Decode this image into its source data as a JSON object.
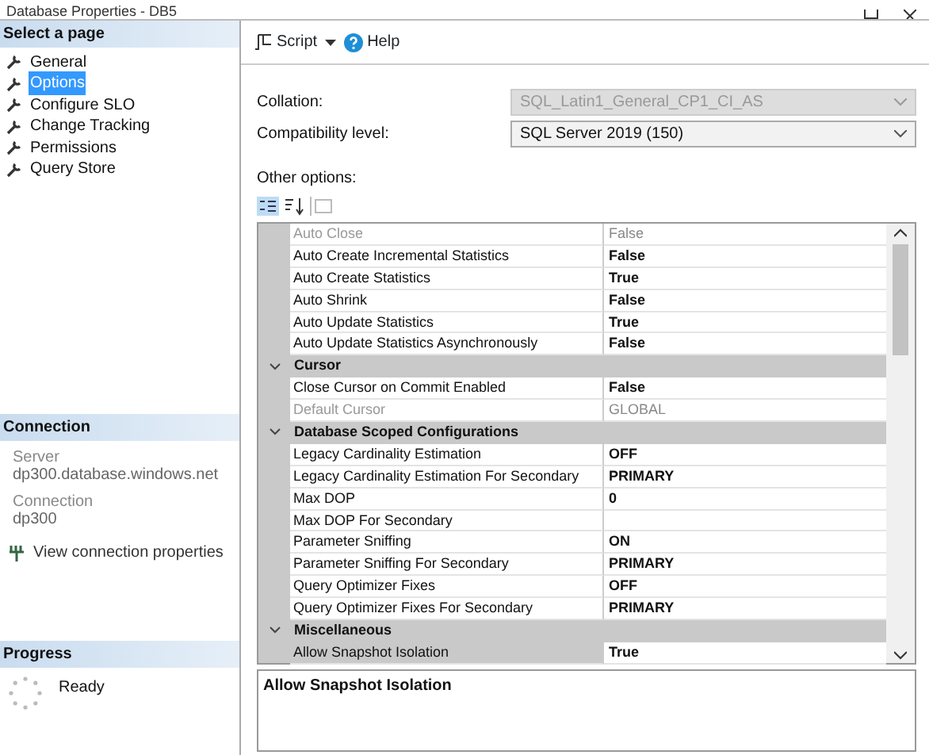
{
  "window": {
    "title": "Database Properties - DB5"
  },
  "sidebar": {
    "header": "Select a page",
    "items": [
      {
        "label": "General",
        "selected": false
      },
      {
        "label": "Options",
        "selected": true
      },
      {
        "label": "Configure SLO",
        "selected": false
      },
      {
        "label": "Change Tracking",
        "selected": false
      },
      {
        "label": "Permissions",
        "selected": false
      },
      {
        "label": "Query Store",
        "selected": false
      }
    ]
  },
  "connection": {
    "header": "Connection",
    "server_label": "Server",
    "server": "dp300.database.windows.net",
    "connection_label": "Connection",
    "connection": "dp300",
    "link": "View connection properties"
  },
  "progress": {
    "header": "Progress",
    "status": "Ready"
  },
  "toolbar": {
    "script": "Script",
    "help": "Help"
  },
  "collation": {
    "label": "Collation:",
    "value": "SQL_Latin1_General_CP1_CI_AS",
    "disabled": true
  },
  "compatibility": {
    "label": "Compatibility level:",
    "value": "SQL Server 2019 (150)",
    "disabled": false
  },
  "other_options": {
    "label": "Other options:"
  },
  "grid": [
    {
      "kind": "property",
      "name": "Auto Close",
      "value": "False",
      "bold": false,
      "disabled": true,
      "selected": false
    },
    {
      "kind": "property",
      "name": "Auto Create Incremental Statistics",
      "value": "False",
      "bold": true,
      "disabled": false,
      "selected": false
    },
    {
      "kind": "property",
      "name": "Auto Create Statistics",
      "value": "True",
      "bold": true,
      "disabled": false,
      "selected": false
    },
    {
      "kind": "property",
      "name": "Auto Shrink",
      "value": "False",
      "bold": true,
      "disabled": false,
      "selected": false
    },
    {
      "kind": "property",
      "name": "Auto Update Statistics",
      "value": "True",
      "bold": true,
      "disabled": false,
      "selected": false
    },
    {
      "kind": "property",
      "name": "Auto Update Statistics Asynchronously",
      "value": "False",
      "bold": true,
      "disabled": false,
      "selected": false
    },
    {
      "kind": "category",
      "name": "Cursor",
      "expanded": true
    },
    {
      "kind": "property",
      "name": "Close Cursor on Commit Enabled",
      "value": "False",
      "bold": true,
      "disabled": false,
      "selected": false
    },
    {
      "kind": "property",
      "name": "Default Cursor",
      "value": "GLOBAL",
      "bold": false,
      "disabled": true,
      "selected": false
    },
    {
      "kind": "category",
      "name": "Database Scoped Configurations",
      "expanded": true
    },
    {
      "kind": "property",
      "name": "Legacy Cardinality Estimation",
      "value": "OFF",
      "bold": true,
      "disabled": false,
      "selected": false
    },
    {
      "kind": "property",
      "name": "Legacy Cardinality Estimation For Secondary",
      "value": "PRIMARY",
      "bold": true,
      "disabled": false,
      "selected": false
    },
    {
      "kind": "property",
      "name": "Max DOP",
      "value": "0",
      "bold": true,
      "disabled": false,
      "selected": false
    },
    {
      "kind": "property",
      "name": "Max DOP For Secondary",
      "disabled": false,
      "selected": false
    },
    {
      "kind": "property",
      "name": "Parameter Sniffing",
      "value": "ON",
      "bold": true,
      "disabled": false,
      "selected": false
    },
    {
      "kind": "property",
      "name": "Parameter Sniffing For Secondary",
      "value": "PRIMARY",
      "bold": true,
      "disabled": false,
      "selected": false
    },
    {
      "kind": "property",
      "name": "Query Optimizer Fixes",
      "value": "OFF",
      "bold": true,
      "disabled": false,
      "selected": false
    },
    {
      "kind": "property",
      "name": "Query Optimizer Fixes For Secondary",
      "value": "PRIMARY",
      "bold": true,
      "disabled": false,
      "selected": false
    },
    {
      "kind": "category",
      "name": "Miscellaneous",
      "expanded": true
    },
    {
      "kind": "property",
      "name": "Allow Snapshot Isolation",
      "value": "True",
      "bold": true,
      "disabled": false,
      "selected": true
    }
  ],
  "description": {
    "title": "Allow Snapshot Isolation"
  }
}
